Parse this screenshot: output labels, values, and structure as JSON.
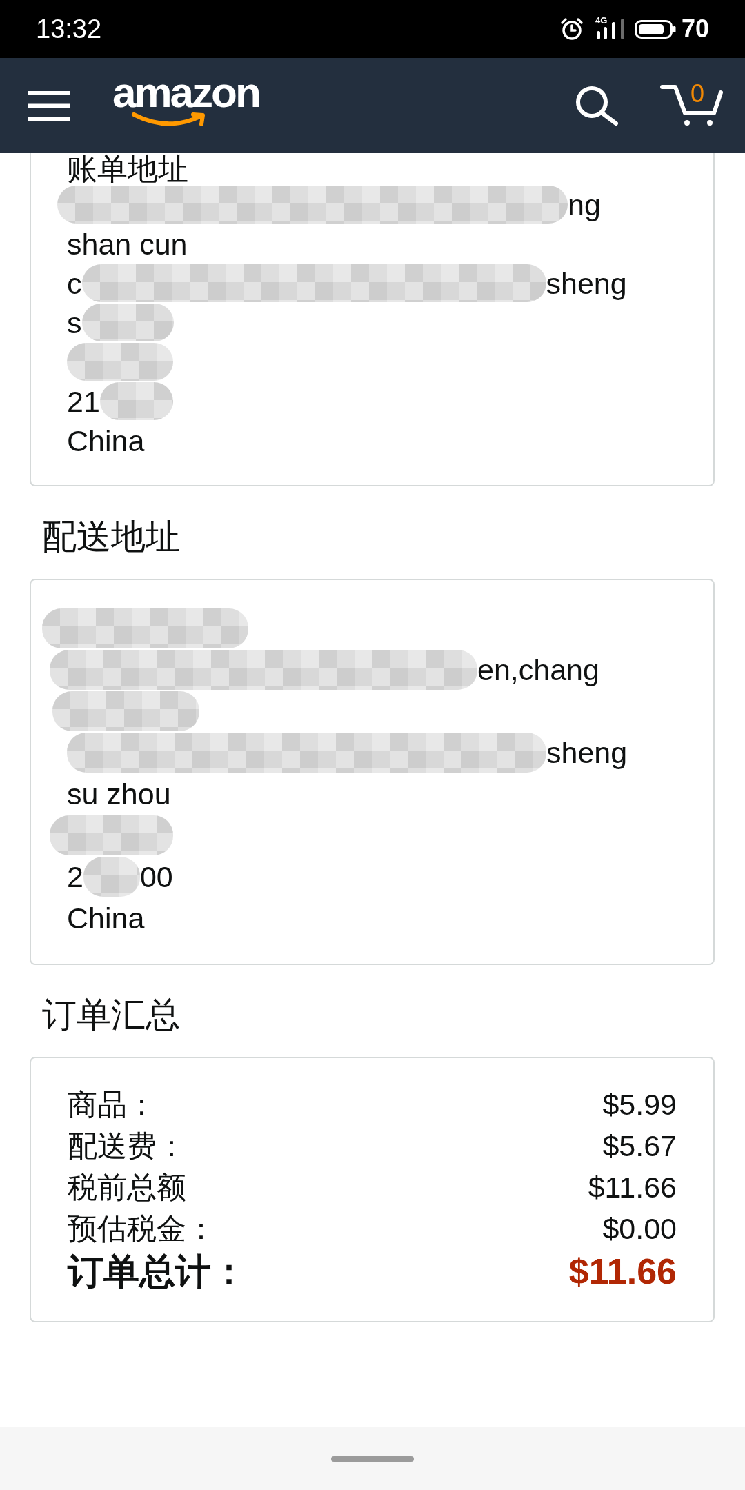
{
  "status_bar": {
    "time": "13:32",
    "network": "4G",
    "battery": "70"
  },
  "header": {
    "logo": "amazon",
    "cart_count": "0"
  },
  "billing_address": {
    "title": "账单地址",
    "lines": [
      {
        "segments": [
          {
            "kind": "redacted"
          },
          {
            "kind": "text",
            "text": "ng"
          }
        ]
      },
      {
        "segments": [
          {
            "kind": "text",
            "text": "shan cun"
          }
        ]
      },
      {
        "segments": [
          {
            "kind": "text",
            "text": "c"
          },
          {
            "kind": "redacted"
          },
          {
            "kind": "text",
            "text": "sheng"
          }
        ]
      },
      {
        "segments": [
          {
            "kind": "text",
            "text": "s"
          },
          {
            "kind": "redacted"
          }
        ]
      },
      {
        "segments": [
          {
            "kind": "redacted"
          }
        ]
      },
      {
        "segments": [
          {
            "kind": "text",
            "text": "21"
          },
          {
            "kind": "redacted"
          }
        ]
      },
      {
        "segments": [
          {
            "kind": "text",
            "text": "China"
          }
        ]
      }
    ]
  },
  "shipping_address": {
    "heading": "配送地址",
    "lines": [
      {
        "segments": [
          {
            "kind": "redacted"
          }
        ]
      },
      {
        "segments": [
          {
            "kind": "redacted"
          },
          {
            "kind": "text",
            "text": "en,chang"
          }
        ]
      },
      {
        "segments": [
          {
            "kind": "redacted"
          }
        ]
      },
      {
        "segments": [
          {
            "kind": "redacted"
          },
          {
            "kind": "text",
            "text": "sheng"
          }
        ]
      },
      {
        "segments": [
          {
            "kind": "text",
            "text": "su zhou"
          }
        ]
      },
      {
        "segments": [
          {
            "kind": "redacted"
          }
        ]
      },
      {
        "segments": [
          {
            "kind": "text",
            "text": "2"
          },
          {
            "kind": "redacted"
          },
          {
            "kind": "text",
            "text": "00"
          }
        ]
      },
      {
        "segments": [
          {
            "kind": "text",
            "text": "China"
          }
        ]
      }
    ]
  },
  "order_summary": {
    "heading": "订单汇总",
    "rows": [
      {
        "kind": "item",
        "label": "商品：",
        "value": "$5.99"
      },
      {
        "kind": "item",
        "label": "配送费：",
        "value": "$5.67"
      },
      {
        "kind": "item",
        "label": "税前总额",
        "value": "$11.66"
      },
      {
        "kind": "item",
        "label": "预估税金：",
        "value": "$0.00"
      },
      {
        "kind": "total",
        "label": "订单总计：",
        "value": "$11.66"
      }
    ]
  }
}
